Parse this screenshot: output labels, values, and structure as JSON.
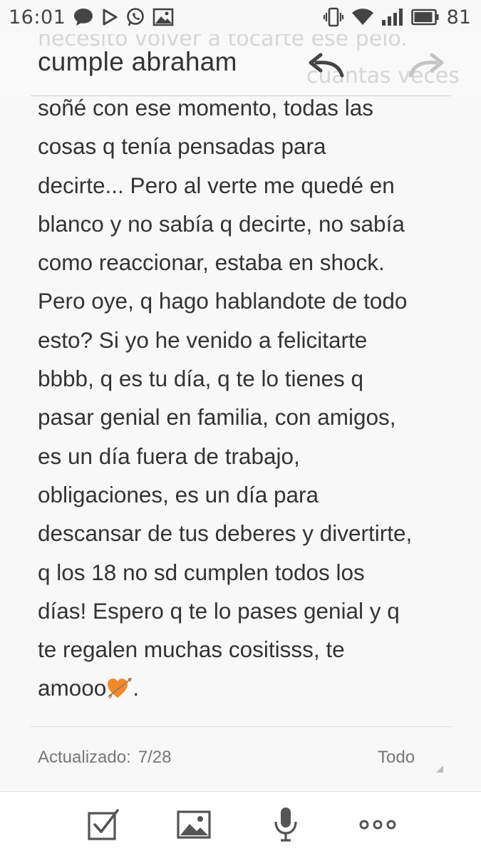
{
  "status_bar": {
    "time": "16:01",
    "battery_level": "81",
    "left_icons": [
      "chat-bubble-icon",
      "play-store-icon",
      "whatsapp-icon",
      "gallery-icon"
    ],
    "right_icons": [
      "vibrate-icon",
      "wifi-icon",
      "signal-icon",
      "battery-icon"
    ]
  },
  "header": {
    "title": "cumple abraham",
    "bleed_line_1": "necesito volver a tocarte ese pelo.",
    "bleed_line_2": "cuantas veces"
  },
  "note": {
    "body": "soñé con ese momento, todas las\ncosas q tenía pensadas para\ndecirte... Pero al verte me quedé en\nblanco y no sabía q decirte, no sabía\ncomo reaccionar, estaba en shock.\nPero oye, q hago hablandote de todo\nesto? Si yo he venido a felicitarte\nbbbb, q es tu día, q te lo tienes q\npasar genial en familia, con amigos,\nes un día fuera de trabajo,\nobligaciones, es un día para\ndescansar de tus deberes y divertirte,\nq los 18 no sd cumplen todos los\ndías! Espero q te lo pases genial y q\nte regalen muchas cositisss, te\namooo",
    "ending": ".",
    "emoji": "heart-with-arrow-icon"
  },
  "footer": {
    "updated_label": "Actualizado:",
    "updated_date": "7/28",
    "folder": "Todo"
  },
  "colors": {
    "background": "#f8f8f8",
    "text": "#333333",
    "muted": "#777777",
    "heart": "#f08a2a"
  }
}
